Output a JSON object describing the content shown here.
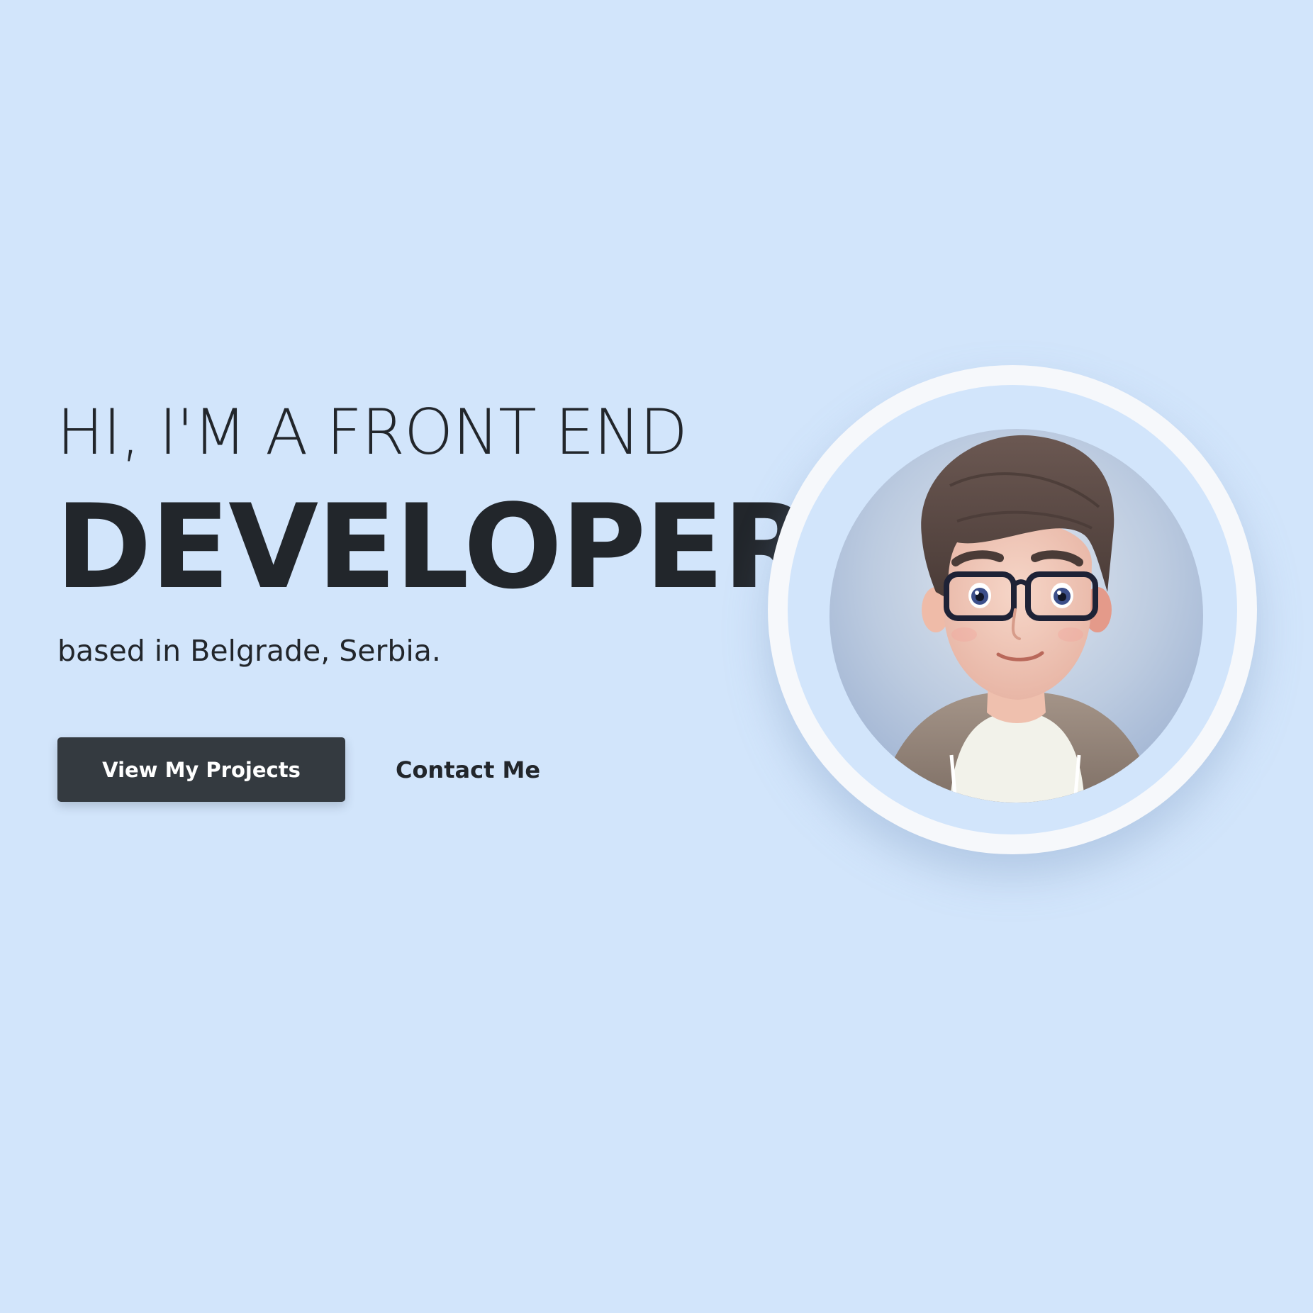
{
  "hero": {
    "intro": "HI, I'M A FRONT END",
    "title": "DEVELOPER",
    "location": "based in Belgrade, Serbia.",
    "primary_button": "View My Projects",
    "secondary_button": "Contact Me"
  },
  "colors": {
    "background": "#d2e5fb",
    "text": "#22262b",
    "primary_button_bg": "#343a40",
    "ring": "#f6f8fb"
  },
  "avatar": {
    "icon": "developer-avatar-illustration"
  }
}
